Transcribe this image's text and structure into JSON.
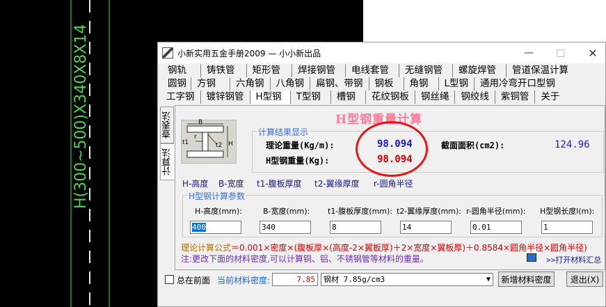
{
  "cad": {
    "vertical_label": "H(300~500)X340X8X14"
  },
  "window": {
    "title": "小新实用五金手册2009 — 小小新出品",
    "controls": {
      "minimize": "—",
      "maximize": "□",
      "close": "✕"
    }
  },
  "menu_rows": [
    [
      "钢轨",
      "铸铁管",
      "矩形管",
      "焊接钢管",
      "电线套管",
      "无缝钢管",
      "螺旋焊管",
      "管道保温计算"
    ],
    [
      "圆钢",
      "方钢",
      "六角钢",
      "八角钢",
      "扁钢、带钢",
      "钢板",
      "角钢",
      "L型钢",
      "通用冷弯开口型钢"
    ],
    [
      "工字钢",
      "镀锌钢管",
      "H型钢",
      "T型钢",
      "槽钢",
      "花纹钢板",
      "钢丝绳",
      "钢绞线",
      "紫铜管",
      "关于"
    ]
  ],
  "active_menu": "H型钢",
  "side_tabs": {
    "lookup": "查表法",
    "calc": "计算法"
  },
  "heading": "H型钢重量计算",
  "result_group": {
    "title": "计算结果显示",
    "theory_weight_label": "理论重量(Kg/m):",
    "theory_weight_value": "98.094",
    "h_weight_label": "H型钢重量(Kg):",
    "h_weight_value": "98.094",
    "area_label": "截面面积(cm2):",
    "area_value": "124.96"
  },
  "legend": [
    "H-高度",
    "B-宽度",
    "t1-腹板厚度",
    "t2-翼缘厚度",
    "r-圆角半径"
  ],
  "params_group": {
    "title": "H型钢计算参数",
    "fields": [
      {
        "label": "H-高度(mm):",
        "value": "400"
      },
      {
        "label": "B-宽度(mm):",
        "value": "340"
      },
      {
        "label": "t1-腹板厚度(mm):",
        "value": "8"
      },
      {
        "label": "t2-翼缘厚度(mm):",
        "value": "14"
      },
      {
        "label": "r-圆角半径(mm):",
        "value": "0.01"
      },
      {
        "label": "H型钢长度l(m):",
        "value": "1"
      }
    ]
  },
  "formula": {
    "label": "理论计算公式",
    "text": "＝0.001×密度×(腹板厚×(高度-2×翼板厚)＋2×宽度×翼板厚)＋0.8584×圆角半径×圆角半径)"
  },
  "note": "注:更改下面的材料密度,可以计算铜、铝、不锈钢管等材料的重量。",
  "open_summary": ">>打开材料汇总",
  "bottom": {
    "always_on_top": "总在前面",
    "density_label": "当前材料密度:",
    "density_value": "7.85",
    "material_select": "钢材 7.85g/cm3",
    "add_density": "新增材料密度",
    "exit": "退出(X)"
  },
  "colors": {
    "heading": "#ff7d9a",
    "result_value_blue": "#1a1ae0",
    "result_value_red": "#e00000",
    "annotation_circle": "#e81515",
    "cad_line": "#4fd04f"
  }
}
